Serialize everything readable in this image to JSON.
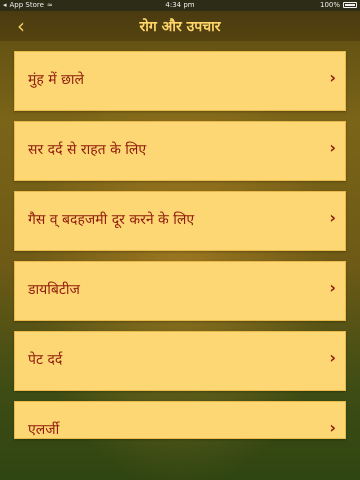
{
  "status_bar": {
    "carrier": "App Store",
    "time": "4:34 pm",
    "battery": "100%"
  },
  "nav": {
    "back_glyph": "‹",
    "title": "रोग और उपचार"
  },
  "items": [
    {
      "label": "मुंह में छाले"
    },
    {
      "label": "सर दर्द से राहत के लिए"
    },
    {
      "label": "गैस व् बदहजमी दूर करने के लिए"
    },
    {
      "label": "डायबिटीज"
    },
    {
      "label": "पेट दर्द"
    },
    {
      "label": "एलर्जी"
    }
  ],
  "chevron_glyph": "›",
  "colors": {
    "card_bg": "#fed775",
    "label_text": "#8f1b0a",
    "title_text": "#ffd66a"
  }
}
